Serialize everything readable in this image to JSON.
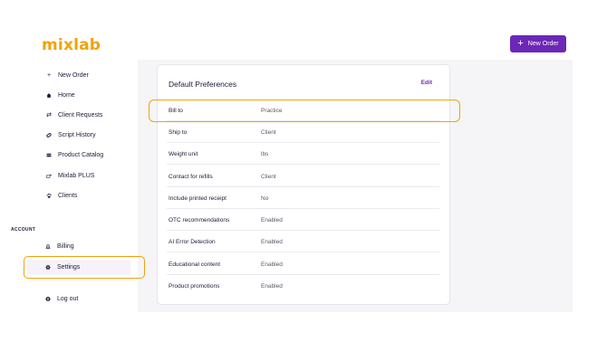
{
  "app": {
    "logo_text": "mixlab"
  },
  "header": {
    "new_order_label": "New Order"
  },
  "sidebar": {
    "items": [
      {
        "label": "New Order",
        "icon": "plus-icon"
      },
      {
        "label": "Home",
        "icon": "home-icon"
      },
      {
        "label": "Client Requests",
        "icon": "swap-arrows-icon"
      },
      {
        "label": "Script History",
        "icon": "pill-icon"
      },
      {
        "label": "Product Catalog",
        "icon": "catalog-icon"
      },
      {
        "label": "Mixlab PLUS",
        "icon": "plus-badge-icon"
      },
      {
        "label": "Clients",
        "icon": "paw-icon"
      }
    ],
    "account_section_label": "ACCOUNT",
    "account_items": [
      {
        "label": "Billing",
        "icon": "bank-icon"
      },
      {
        "label": "Settings",
        "icon": "gear-icon",
        "active": true
      }
    ],
    "logout_label": "Log out"
  },
  "preferences": {
    "title": "Default Preferences",
    "edit_label": "Edit",
    "rows": [
      {
        "label": "Bill to",
        "value": "Practice"
      },
      {
        "label": "Ship to",
        "value": "Client"
      },
      {
        "label": "Weight unit",
        "value": "lbs"
      },
      {
        "label": "Contact for refills",
        "value": "Client"
      },
      {
        "label": "Include printed receipt",
        "value": "No"
      },
      {
        "label": "OTC recommendations",
        "value": "Enabled"
      },
      {
        "label": "AI Error Detection",
        "value": "Enabled"
      },
      {
        "label": "Educational content",
        "value": "Enabled"
      },
      {
        "label": "Product promotions",
        "value": "Enabled"
      }
    ]
  },
  "colors": {
    "accent": "#6c27b8",
    "highlight": "#f2a20b",
    "logo": "#f2a20b"
  }
}
